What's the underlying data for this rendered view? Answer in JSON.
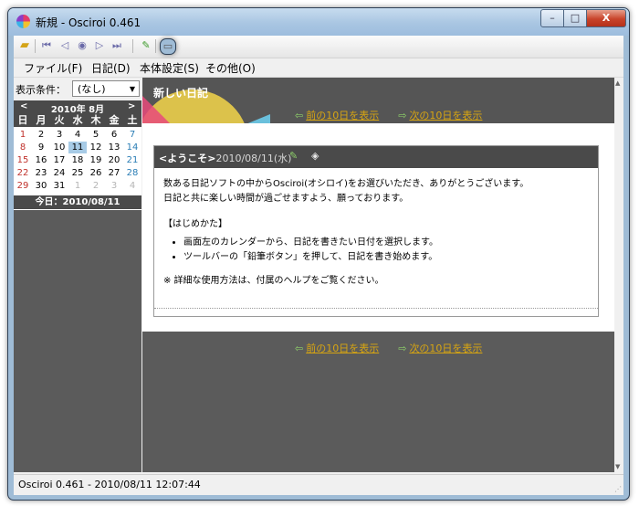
{
  "window": {
    "title": "新規 - Osciroi 0.461",
    "btn_min": "–",
    "btn_max": "□",
    "btn_close": "X"
  },
  "toolbar": {
    "icons": [
      "folder-icon",
      "first-icon",
      "prev-icon",
      "today-icon",
      "next-icon",
      "last-icon",
      "pencil-icon",
      "window-icon"
    ]
  },
  "menu": {
    "file": "ファイル(F)",
    "diary": "日記(D)",
    "settings": "本体設定(S)",
    "other": "その他(O)"
  },
  "filter": {
    "label": "表示条件：",
    "value": "(なし)"
  },
  "calendar": {
    "prev": "<",
    "next": ">",
    "year_month": "2010年 8月",
    "dow": [
      "日",
      "月",
      "火",
      "水",
      "木",
      "金",
      "土"
    ],
    "weeks": [
      [
        "1",
        "2",
        "3",
        "4",
        "5",
        "6",
        "7"
      ],
      [
        "8",
        "9",
        "10",
        "11",
        "12",
        "13",
        "14"
      ],
      [
        "15",
        "16",
        "17",
        "18",
        "19",
        "20",
        "21"
      ],
      [
        "22",
        "23",
        "24",
        "25",
        "26",
        "27",
        "28"
      ],
      [
        "29",
        "30",
        "31",
        "1",
        "2",
        "3",
        "4"
      ]
    ],
    "today": "今日：2010/08/11"
  },
  "content": {
    "new_diary": "新しい日記",
    "prev10": "前の10日を表示",
    "next10": "次の10日を表示",
    "entry": {
      "title": "<ようこそ>",
      "date": "- 2010/08/11(水)",
      "line1": "数ある日記ソフトの中からOsciroi(オシロイ)をお選びいただき、ありがとうございます。",
      "line2": "日記と共に楽しい時間が過ごせますよう、願っております。",
      "heading": "【はじめかた】",
      "bullet1": "画面左のカレンダーから、日記を書きたい日付を選択します。",
      "bullet2": "ツールバーの「鉛筆ボタン」を押して、日記を書き始めます。",
      "note": "※ 詳細な使用方法は、付属のヘルプをご覧ください。"
    }
  },
  "status": {
    "text": "Osciroi 0.461 - 2010/08/11 12:07:44"
  }
}
